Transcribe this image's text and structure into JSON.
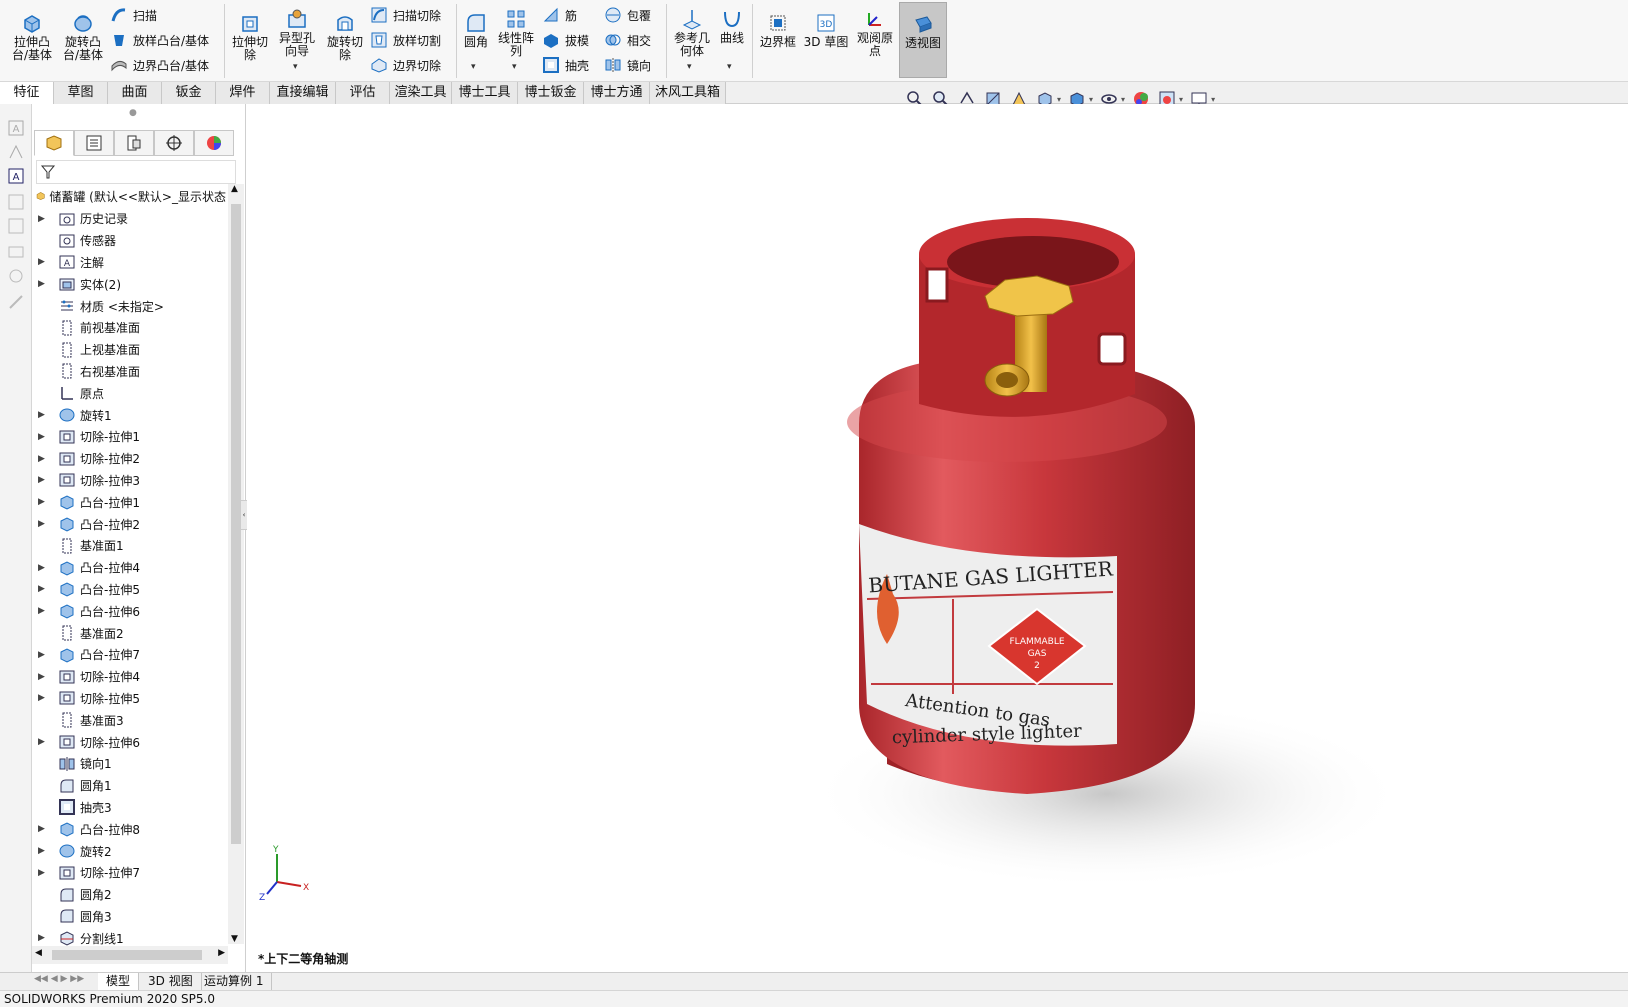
{
  "ribbon": {
    "extrude_boss": "拉伸凸\n台/基体",
    "revolve_boss": "旋转凸\n台/基体",
    "sweep": "扫描",
    "loft_boss": "放样凸台/基体",
    "boundary_boss": "边界凸台/基体",
    "extrude_cut": "拉伸切\n除",
    "hole_wizard": "异型孔\n向导",
    "revolve_cut": "旋转切\n除",
    "sweep_cut": "扫描切除",
    "loft_cut": "放样切割",
    "boundary_cut": "边界切除",
    "fillet": "圆角",
    "linear_pattern": "线性阵\n列",
    "rib": "筋",
    "draft": "拔模",
    "shell": "抽壳",
    "wrap": "包覆",
    "intersect": "相交",
    "mirror": "镜向",
    "ref_geometry": "参考几\n何体",
    "curves": "曲线",
    "bounding_box": "边界框",
    "sketch_3d": "3D 草图",
    "view_origin": "观阅原\n点",
    "perspective": "透视图"
  },
  "tabs": [
    "特征",
    "草图",
    "曲面",
    "钣金",
    "焊件",
    "直接编辑",
    "评估",
    "渲染工具",
    "博士工具",
    "博士钣金",
    "博士方通",
    "沐风工具箱"
  ],
  "feature_tree": {
    "root": "储蓄罐  (默认<<默认>_显示状态",
    "items": [
      {
        "label": "历史记录",
        "icon": "history-folder-icon",
        "expand": true
      },
      {
        "label": "传感器",
        "icon": "sensor-icon",
        "expand": false
      },
      {
        "label": "注解",
        "icon": "annotation-icon",
        "expand": true
      },
      {
        "label": "实体(2)",
        "icon": "solid-bodies-icon",
        "expand": true
      },
      {
        "label": "材质 <未指定>",
        "icon": "material-icon",
        "expand": false
      },
      {
        "label": "前视基准面",
        "icon": "plane-icon",
        "expand": false
      },
      {
        "label": "上视基准面",
        "icon": "plane-icon",
        "expand": false
      },
      {
        "label": "右视基准面",
        "icon": "plane-icon",
        "expand": false
      },
      {
        "label": "原点",
        "icon": "origin-icon",
        "expand": false
      },
      {
        "label": "旋转1",
        "icon": "revolve-icon",
        "expand": true
      },
      {
        "label": "切除-拉伸1",
        "icon": "cut-extrude-icon",
        "expand": true
      },
      {
        "label": "切除-拉伸2",
        "icon": "cut-extrude-icon",
        "expand": true
      },
      {
        "label": "切除-拉伸3",
        "icon": "cut-extrude-icon",
        "expand": true
      },
      {
        "label": "凸台-拉伸1",
        "icon": "boss-extrude-icon",
        "expand": true
      },
      {
        "label": "凸台-拉伸2",
        "icon": "boss-extrude-icon",
        "expand": true
      },
      {
        "label": "基准面1",
        "icon": "plane-icon",
        "expand": false
      },
      {
        "label": "凸台-拉伸4",
        "icon": "boss-extrude-icon",
        "expand": true
      },
      {
        "label": "凸台-拉伸5",
        "icon": "boss-extrude-icon",
        "expand": true
      },
      {
        "label": "凸台-拉伸6",
        "icon": "boss-extrude-icon",
        "expand": true
      },
      {
        "label": "基准面2",
        "icon": "plane-icon",
        "expand": false
      },
      {
        "label": "凸台-拉伸7",
        "icon": "boss-extrude-icon",
        "expand": true
      },
      {
        "label": "切除-拉伸4",
        "icon": "cut-extrude-icon",
        "expand": true
      },
      {
        "label": "切除-拉伸5",
        "icon": "cut-extrude-icon",
        "expand": true
      },
      {
        "label": "基准面3",
        "icon": "plane-icon",
        "expand": false
      },
      {
        "label": "切除-拉伸6",
        "icon": "cut-extrude-icon",
        "expand": true
      },
      {
        "label": "镜向1",
        "icon": "mirror-icon",
        "expand": false
      },
      {
        "label": "圆角1",
        "icon": "fillet-icon",
        "expand": false
      },
      {
        "label": "抽壳3",
        "icon": "shell-icon",
        "expand": false
      },
      {
        "label": "凸台-拉伸8",
        "icon": "boss-extrude-icon",
        "expand": true
      },
      {
        "label": "旋转2",
        "icon": "revolve-icon",
        "expand": true
      },
      {
        "label": "切除-拉伸7",
        "icon": "cut-extrude-icon",
        "expand": true
      },
      {
        "label": "圆角2",
        "icon": "fillet-icon",
        "expand": false
      },
      {
        "label": "圆角3",
        "icon": "fillet-icon",
        "expand": false
      },
      {
        "label": "分割线1",
        "icon": "split-line-icon",
        "expand": true
      }
    ]
  },
  "viewport": {
    "view_name": "*上下二等角轴测",
    "label_line1": "BUTANE GAS LIGHTER",
    "label_line2": "Attention to gas",
    "label_line3": "cylinder style lighter",
    "diamond_line1": "FLAMMABLE",
    "diamond_line2": "GAS",
    "diamond_line3": "2",
    "axis_x": "X",
    "axis_y": "Y",
    "axis_z": "Z"
  },
  "bottom_tabs": [
    "模型",
    "3D 视图",
    "运动算例 1"
  ],
  "status": "SOLIDWORKS Premium 2020 SP5.0",
  "colors": {
    "tank_red": "#c8373c",
    "valve_gold": "#d9a529",
    "ribbon_blue": "#1c6fc2"
  }
}
